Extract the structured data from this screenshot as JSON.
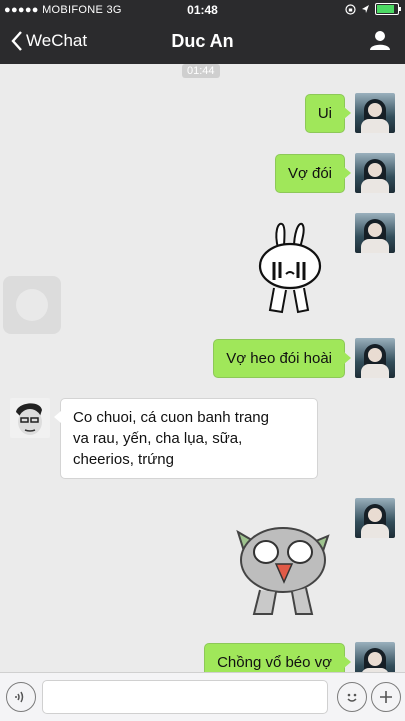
{
  "status_bar": {
    "carrier": "●●●●● MOBIFONE  3G",
    "time": "01:48"
  },
  "nav": {
    "back_label": "WeChat",
    "title": "Duc An"
  },
  "timestamp": "01:44",
  "messages": [
    {
      "text": "Ui"
    },
    {
      "text": "Vợ đói"
    },
    {
      "text": "Vợ heo đói hoài"
    },
    {
      "text": "Co chuoi, cá cuon banh trang\nva rau, yến, cha lụa, sữa,\ncheerios, trứng"
    },
    {
      "text": "Chồng vổ béo vợ"
    }
  ],
  "colors": {
    "bar": "#2b2b2d",
    "my_bubble": "#a0e75a",
    "their_bubble": "#ffffff",
    "background": "#ebebeb"
  },
  "icons": [
    "back-chevron-icon",
    "person-icon",
    "voice-icon",
    "emoji-icon",
    "plus-icon"
  ]
}
